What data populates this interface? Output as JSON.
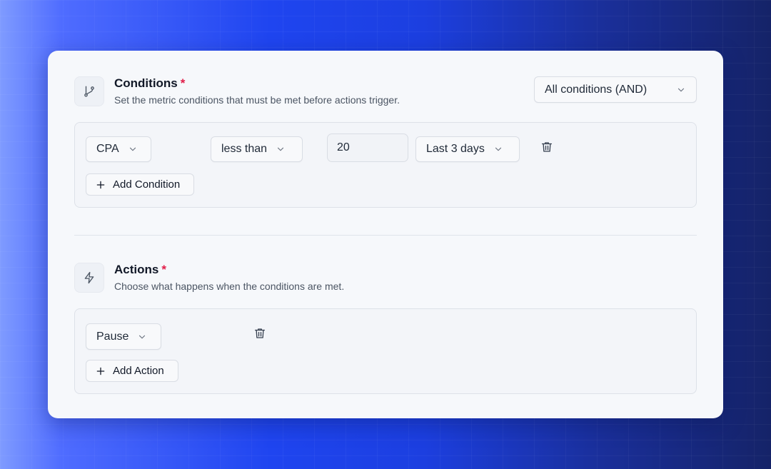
{
  "conditions": {
    "title": "Conditions",
    "required_mark": "*",
    "subtitle": "Set the metric conditions that must be met before actions trigger.",
    "icon": "git-branch-icon",
    "logic_select": "All conditions (AND)",
    "rows": [
      {
        "metric": "CPA",
        "operator": "less than",
        "value": "20",
        "window": "Last 3 days"
      }
    ],
    "add_label": "Add Condition"
  },
  "actions": {
    "title": "Actions",
    "required_mark": "*",
    "subtitle": "Choose what happens when the conditions are met.",
    "icon": "lightning-icon",
    "rows": [
      {
        "action": "Pause"
      }
    ],
    "add_label": "Add Action"
  },
  "colors": {
    "required": "#e11d48",
    "card_bg": "#f6f8fb",
    "accent_bg": "#1f45f0"
  }
}
